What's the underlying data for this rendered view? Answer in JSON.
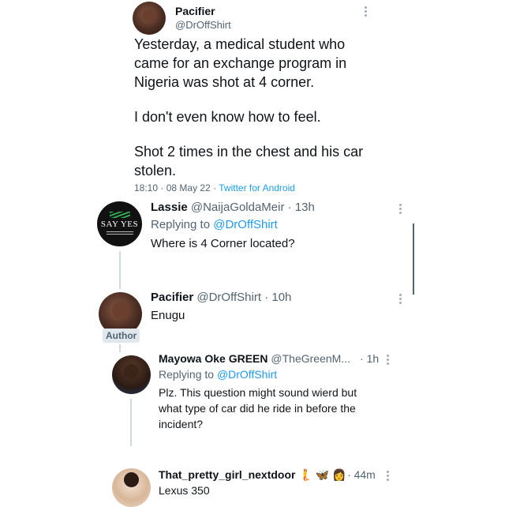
{
  "main_tweet": {
    "name": "Pacifier",
    "handle": "@DrOffShirt",
    "body_1": "Yesterday, a medical student who",
    "body_2": "came for an exchange program in",
    "body_3": "Nigeria was shot at 4 corner.",
    "body_4": "I don't even know how to feel.",
    "body_5": "Shot 2 times in the chest and his car",
    "body_6": "stolen.",
    "time": "18:10",
    "date": "08 May 22",
    "source": "Twitter for Android"
  },
  "replies": [
    {
      "name": "Lassie",
      "handle": "@NaijaGoldaMeir",
      "age": "13h",
      "replying_label": "Replying to",
      "replying_to": "@DrOffShirt",
      "text": "Where is 4 Corner located?",
      "avatar_text": "SAY YES"
    },
    {
      "name": "Pacifier",
      "handle": "@DrOffShirt",
      "age": "10h",
      "text": "Enugu",
      "badge": "Author"
    },
    {
      "name": "Mayowa Oke GREEN",
      "handle": "@TheGreenM...",
      "age": "1h",
      "replying_label": "Replying to",
      "replying_to": "@DrOffShirt",
      "text_1": "Plz. This question might sound wierd but",
      "text_2": "what type of car did he ride in before the",
      "text_3": "incident?"
    },
    {
      "name": "That_pretty_girl_nextdoor",
      "emojis": "🧜 🦋 👩",
      "age": "44m",
      "text": "Lexus 350"
    }
  ],
  "separator": "·"
}
